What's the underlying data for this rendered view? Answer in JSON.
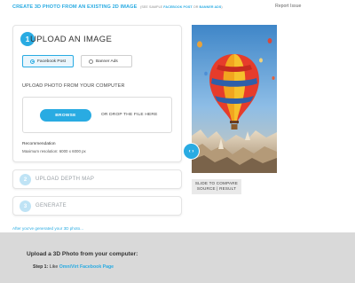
{
  "header": {
    "title": "CREATE 3D PHOTO FROM AN EXISTING 2D IMAGE",
    "subtitle_prefix": "(SEE SAMPLE",
    "sample_facebook": "FACEBOOK POST",
    "subtitle_or": "OR",
    "sample_banner": "BANNER ADS",
    "subtitle_suffix": ")",
    "report_link": "Report Issue"
  },
  "upload_card": {
    "step_number": "1",
    "heading": "UPLOAD AN IMAGE",
    "format_options": [
      {
        "label": "Facebook Post",
        "selected": true
      },
      {
        "label": "Banner Ads",
        "selected": false
      }
    ],
    "section_label": "UPLOAD PHOTO FROM YOUR COMPUTER",
    "browse_label": "BROWSE",
    "drop_text": "OR DROP THE FILE HERE",
    "recommendation_title": "Recommendation",
    "recommendation_text": "Maximum resolution: 6000 x 6000 px"
  },
  "steps": [
    {
      "number": "2",
      "label": "UPLOAD DEPTH MAP"
    },
    {
      "number": "3",
      "label": "GENERATE"
    }
  ],
  "after_link": "After you've generated your 3D photo...",
  "preview": {
    "handle_icon": "‹ ›",
    "compare_label_line1": "SLIDE TO COMPARE",
    "compare_label_line2": "SOURCE | RESULT"
  },
  "howto": {
    "title": "Upload a 3D Photo from your computer:",
    "step1_label": "Step 1:",
    "step1_text": "Like",
    "step1_link": "OmniVirt Facebook Page"
  },
  "colors": {
    "accent": "#29abe2",
    "panel_gray": "#d9d9d9"
  }
}
